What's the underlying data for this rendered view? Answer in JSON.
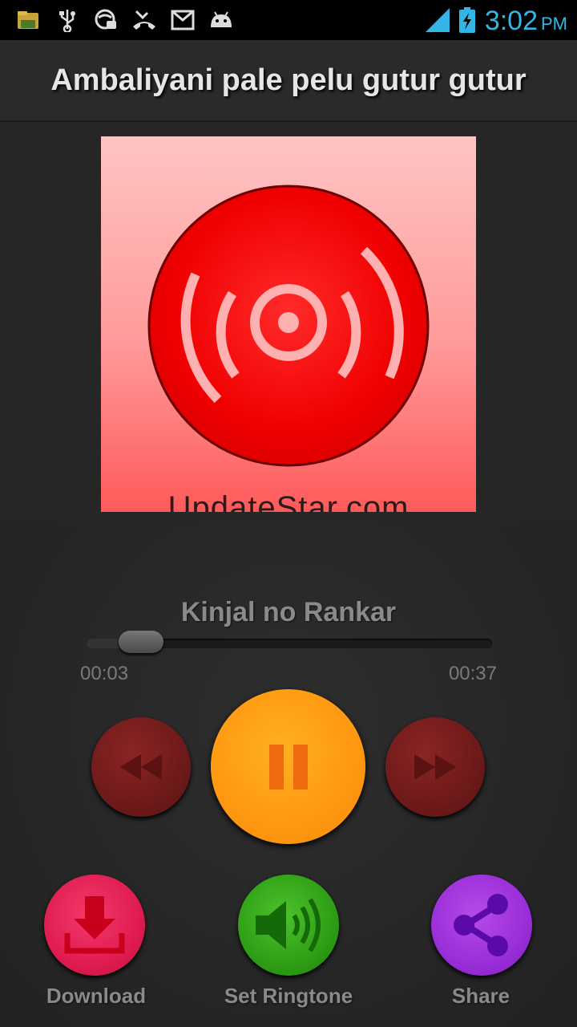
{
  "status_bar": {
    "time": "3:02",
    "ampm": "PM",
    "icons": [
      "file-manager-icon",
      "usb-icon",
      "browser-icon",
      "missed-call-icon",
      "gmail-icon",
      "android-icon",
      "signal-icon",
      "battery-charging-icon"
    ],
    "accent": "#33b5e5"
  },
  "header": {
    "title": "Ambaliyani pale pelu gutur gutur"
  },
  "album": {
    "watermark": "UpdateStar.com",
    "disc_color": "#ff0000"
  },
  "player": {
    "track_title": "Kinjal no Rankar",
    "current_time": "00:03",
    "total_time": "00:37",
    "progress": 0.08,
    "play_state": "playing"
  },
  "actions": {
    "download_label": "Download",
    "ringtone_label": "Set Ringtone",
    "share_label": "Share"
  },
  "colors": {
    "play_button": "#ff9a12",
    "nav_buttons": "#6e1a1a",
    "download": "#e01c50",
    "ringtone": "#2f9e16",
    "share": "#9a2ed8"
  }
}
